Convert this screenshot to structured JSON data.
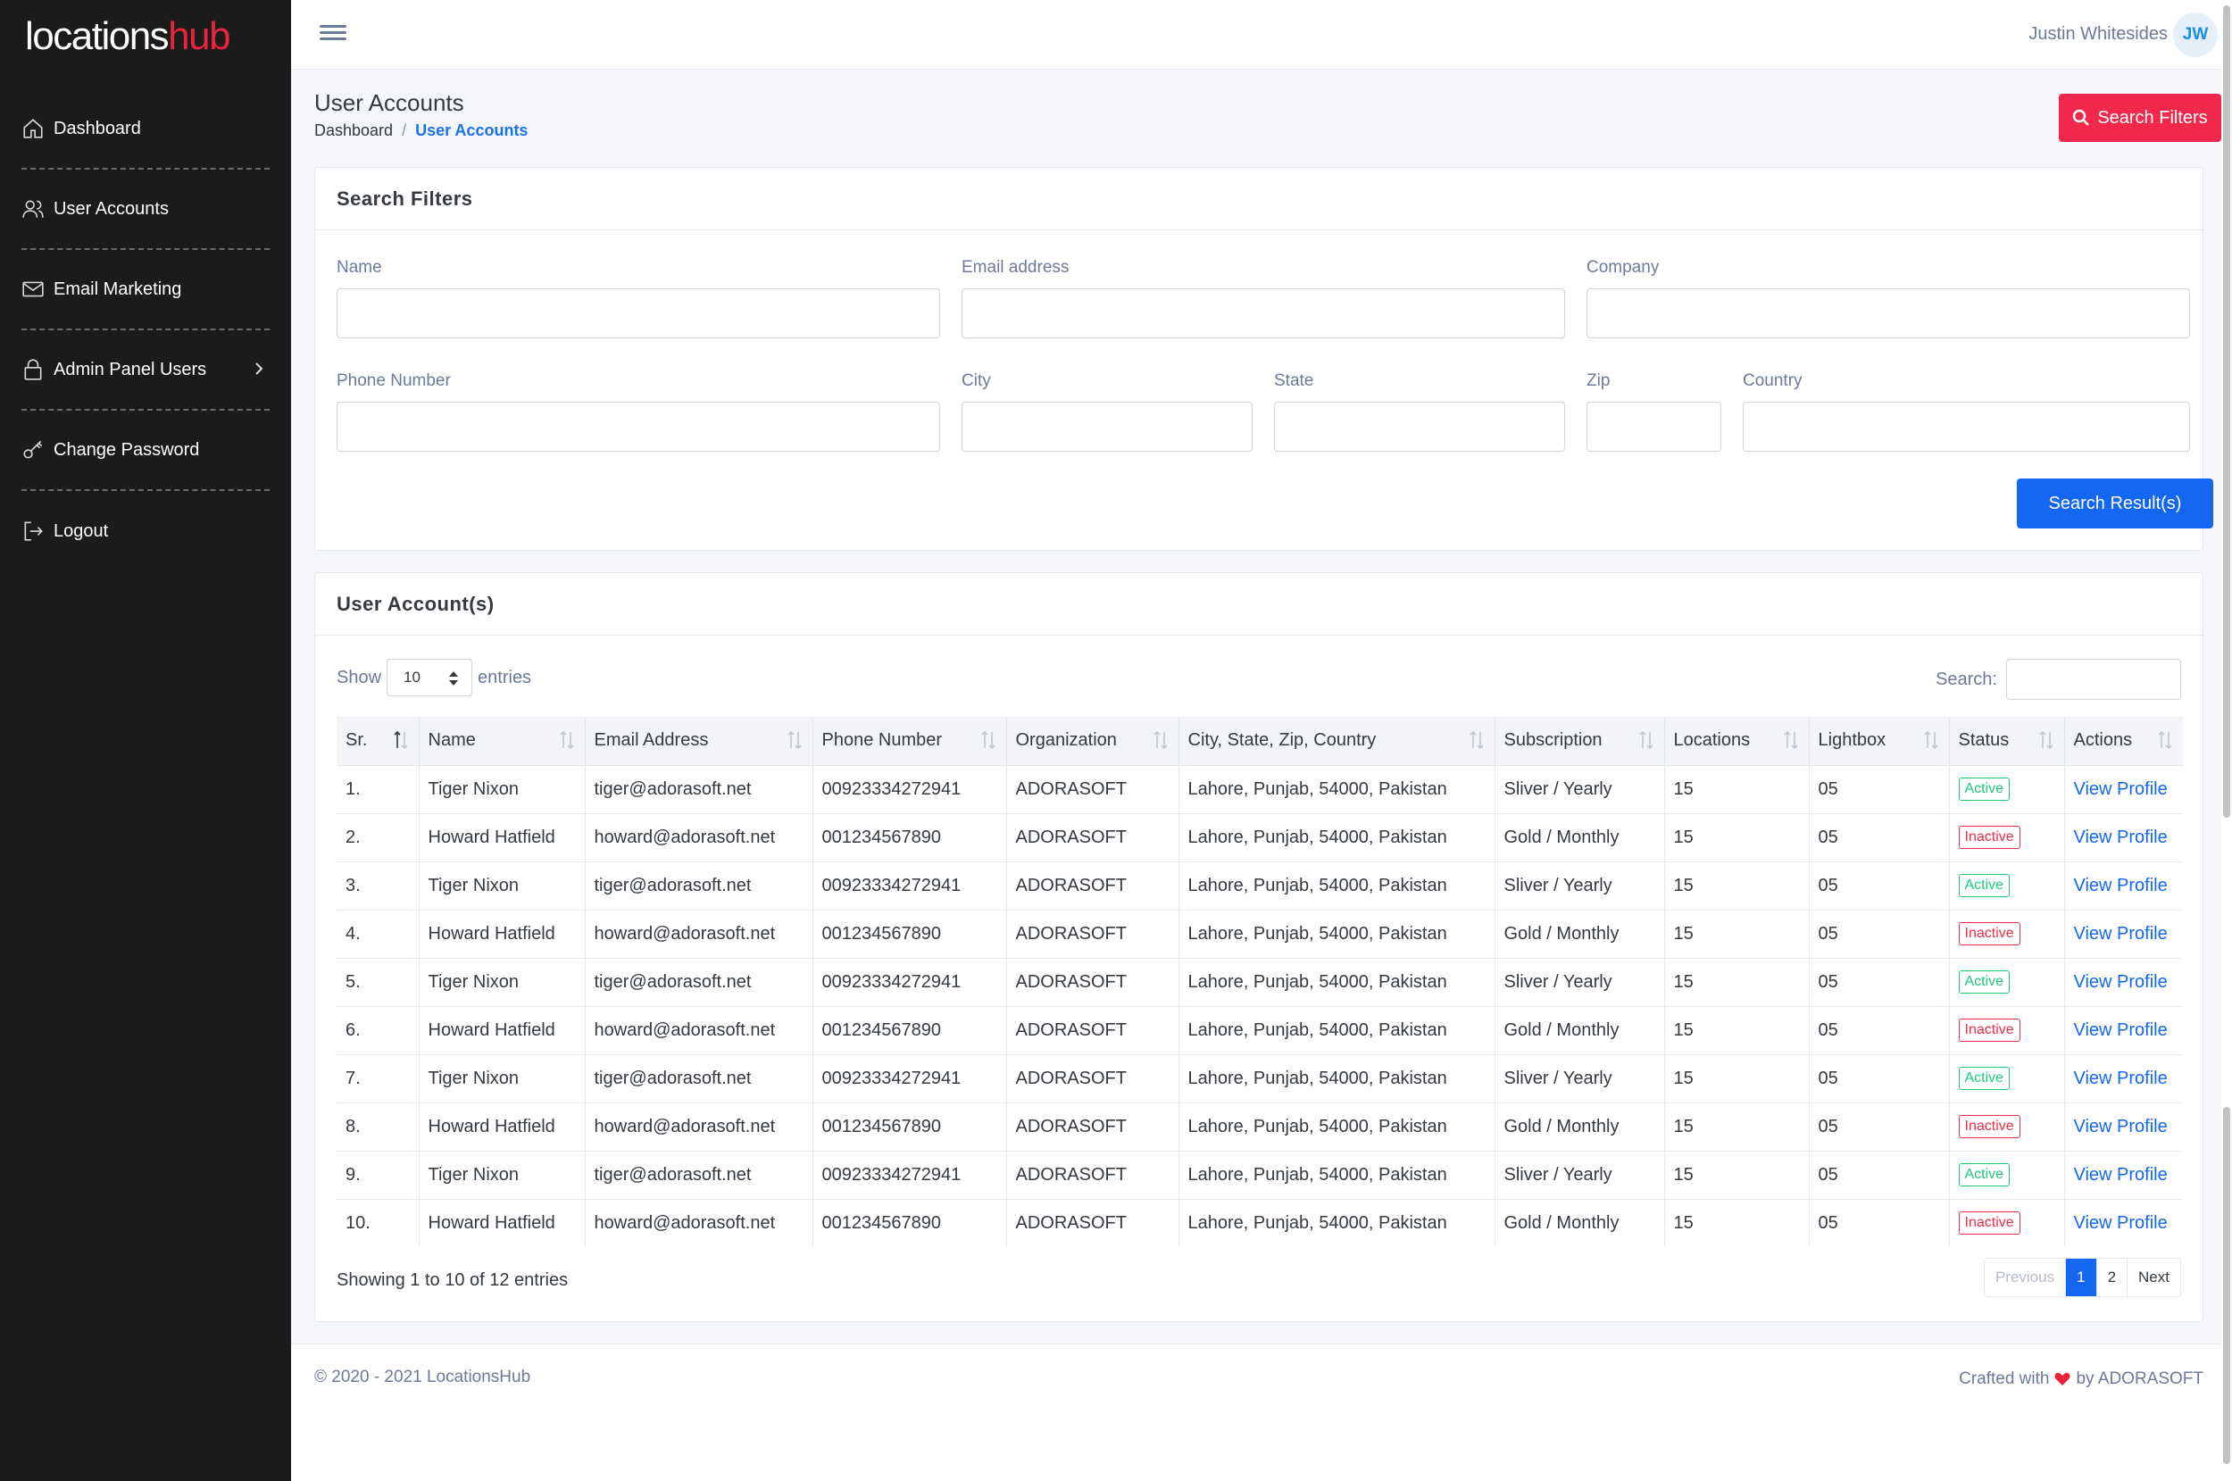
{
  "app": {
    "logo_part1": "locations",
    "logo_part2": "hub",
    "brand_red": "#e8223a"
  },
  "sidebar": {
    "items": [
      {
        "label": "Dashboard",
        "icon": "home-icon"
      },
      {
        "label": "User Accounts",
        "icon": "users-icon"
      },
      {
        "label": "Email Marketing",
        "icon": "mail-icon"
      },
      {
        "label": "Admin Panel Users",
        "icon": "lock-icon"
      },
      {
        "label": "Change Password",
        "icon": "key-icon"
      },
      {
        "label": "Logout",
        "icon": "logout-icon"
      }
    ]
  },
  "header": {
    "user_name": "Justin Whitesides",
    "user_initials": "JW"
  },
  "page": {
    "title": "User Accounts",
    "breadcrumb_home": "Dashboard",
    "breadcrumb_sep": "/",
    "breadcrumb_current": "User Accounts",
    "search_filters_button": "Search Filters"
  },
  "filters": {
    "title": "Search Filters",
    "name_label": "Name",
    "email_label": "Email address",
    "company_label": "Company",
    "phone_label": "Phone Number",
    "city_label": "City",
    "state_label": "State",
    "zip_label": "Zip",
    "country_label": "Country",
    "submit_label": "Search Result(s)"
  },
  "results": {
    "title": "User Account(s)",
    "show_label": "Show",
    "page_length": "10",
    "entries_label": "entries",
    "search_label": "Search:",
    "columns": [
      "Sr.",
      "Name",
      "Email Address",
      "Phone Number",
      "Organization",
      "City, State, Zip, Country",
      "Subscription",
      "Locations",
      "Lightbox",
      "Status",
      "Actions"
    ],
    "rows": [
      {
        "sr": "1.",
        "name": "Tiger Nixon",
        "email": "tiger@adorasoft.net",
        "phone": "00923334272941",
        "org": "ADORASOFT",
        "location": "Lahore, Punjab, 54000, Pakistan",
        "subscription": "Sliver / Yearly",
        "locations": "15",
        "lightbox": "05",
        "status": "Active",
        "action": "View Profile"
      },
      {
        "sr": "2.",
        "name": "Howard Hatfield",
        "email": "howard@adorasoft.net",
        "phone": "001234567890",
        "org": "ADORASOFT",
        "location": "Lahore, Punjab, 54000, Pakistan",
        "subscription": "Gold / Monthly",
        "locations": "15",
        "lightbox": "05",
        "status": "Inactive",
        "action": "View Profile"
      },
      {
        "sr": "3.",
        "name": "Tiger Nixon",
        "email": "tiger@adorasoft.net",
        "phone": "00923334272941",
        "org": "ADORASOFT",
        "location": "Lahore, Punjab, 54000, Pakistan",
        "subscription": "Sliver / Yearly",
        "locations": "15",
        "lightbox": "05",
        "status": "Active",
        "action": "View Profile"
      },
      {
        "sr": "4.",
        "name": "Howard Hatfield",
        "email": "howard@adorasoft.net",
        "phone": "001234567890",
        "org": "ADORASOFT",
        "location": "Lahore, Punjab, 54000, Pakistan",
        "subscription": "Gold / Monthly",
        "locations": "15",
        "lightbox": "05",
        "status": "Inactive",
        "action": "View Profile"
      },
      {
        "sr": "5.",
        "name": "Tiger Nixon",
        "email": "tiger@adorasoft.net",
        "phone": "00923334272941",
        "org": "ADORASOFT",
        "location": "Lahore, Punjab, 54000, Pakistan",
        "subscription": "Sliver / Yearly",
        "locations": "15",
        "lightbox": "05",
        "status": "Active",
        "action": "View Profile"
      },
      {
        "sr": "6.",
        "name": "Howard Hatfield",
        "email": "howard@adorasoft.net",
        "phone": "001234567890",
        "org": "ADORASOFT",
        "location": "Lahore, Punjab, 54000, Pakistan",
        "subscription": "Gold / Monthly",
        "locations": "15",
        "lightbox": "05",
        "status": "Inactive",
        "action": "View Profile"
      },
      {
        "sr": "7.",
        "name": "Tiger Nixon",
        "email": "tiger@adorasoft.net",
        "phone": "00923334272941",
        "org": "ADORASOFT",
        "location": "Lahore, Punjab, 54000, Pakistan",
        "subscription": "Sliver / Yearly",
        "locations": "15",
        "lightbox": "05",
        "status": "Active",
        "action": "View Profile"
      },
      {
        "sr": "8.",
        "name": "Howard Hatfield",
        "email": "howard@adorasoft.net",
        "phone": "001234567890",
        "org": "ADORASOFT",
        "location": "Lahore, Punjab, 54000, Pakistan",
        "subscription": "Gold / Monthly",
        "locations": "15",
        "lightbox": "05",
        "status": "Inactive",
        "action": "View Profile"
      },
      {
        "sr": "9.",
        "name": "Tiger Nixon",
        "email": "tiger@adorasoft.net",
        "phone": "00923334272941",
        "org": "ADORASOFT",
        "location": "Lahore, Punjab, 54000, Pakistan",
        "subscription": "Sliver / Yearly",
        "locations": "15",
        "lightbox": "05",
        "status": "Active",
        "action": "View Profile"
      },
      {
        "sr": "10.",
        "name": "Howard Hatfield",
        "email": "howard@adorasoft.net",
        "phone": "001234567890",
        "org": "ADORASOFT",
        "location": "Lahore, Punjab, 54000, Pakistan",
        "subscription": "Gold / Monthly",
        "locations": "15",
        "lightbox": "05",
        "status": "Inactive",
        "action": "View Profile"
      }
    ],
    "info": "Showing 1 to 10 of 12 entries",
    "pagination": {
      "previous": "Previous",
      "pages": [
        "1",
        "2"
      ],
      "current": "1",
      "next": "Next"
    }
  },
  "footer": {
    "copyright": "© 2020 - 2021 LocationsHub",
    "crafted_prefix": "Crafted with",
    "crafted_suffix": "by ADORASOFT"
  },
  "colors": {
    "accent_blue": "#1467f0",
    "search_filters_red": "#f1284c",
    "active_green": "#1ec978",
    "inactive_red": "#ef2b49",
    "sidebar_bg": "#1b1b1b"
  }
}
